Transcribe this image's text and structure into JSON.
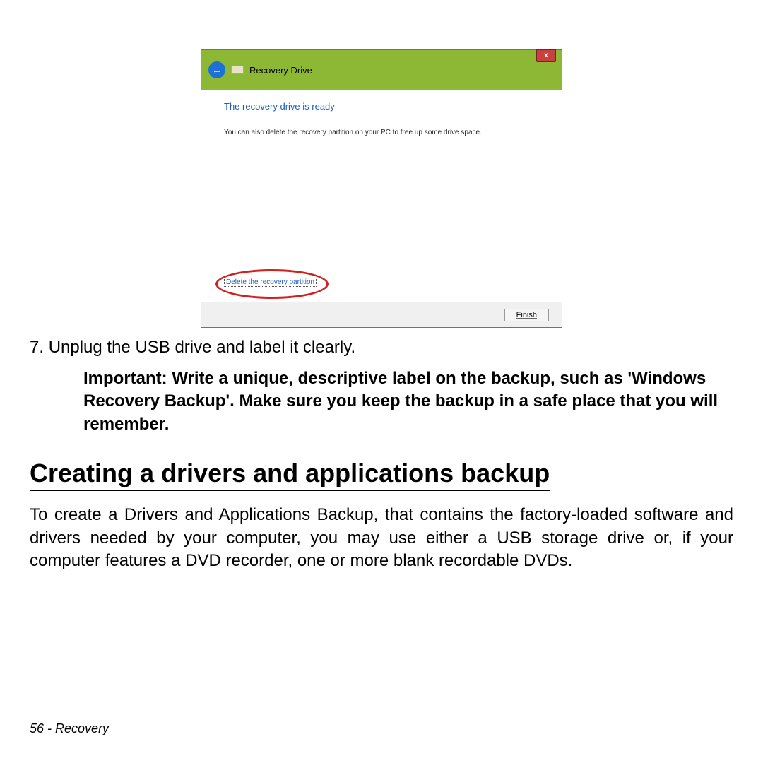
{
  "dialog": {
    "title": "Recovery Drive",
    "close_glyph": "x",
    "heading": "The recovery drive is ready",
    "body_text": "You can also delete the recovery partition on your PC to free up some drive space.",
    "partition_link": "Delete the recovery partition",
    "finish_label": "Finish",
    "back_glyph": "←"
  },
  "step": {
    "number_text": "7.",
    "text": "Unplug the USB drive and label it clearly."
  },
  "important_text": "Important: Write a unique, descriptive label on the backup, such as 'Windows Recovery Backup'. Make sure you keep the backup in a safe place that you will remember.",
  "section": {
    "heading": "Creating a drivers and applications backup",
    "body": "To create a Drivers and Applications Backup, that contains the factory-loaded software and drivers needed by your computer, you may use either a USB storage drive or, if your computer features a DVD recorder, one or more blank recordable DVDs."
  },
  "footer": {
    "page": "56",
    "section": "Recovery"
  }
}
